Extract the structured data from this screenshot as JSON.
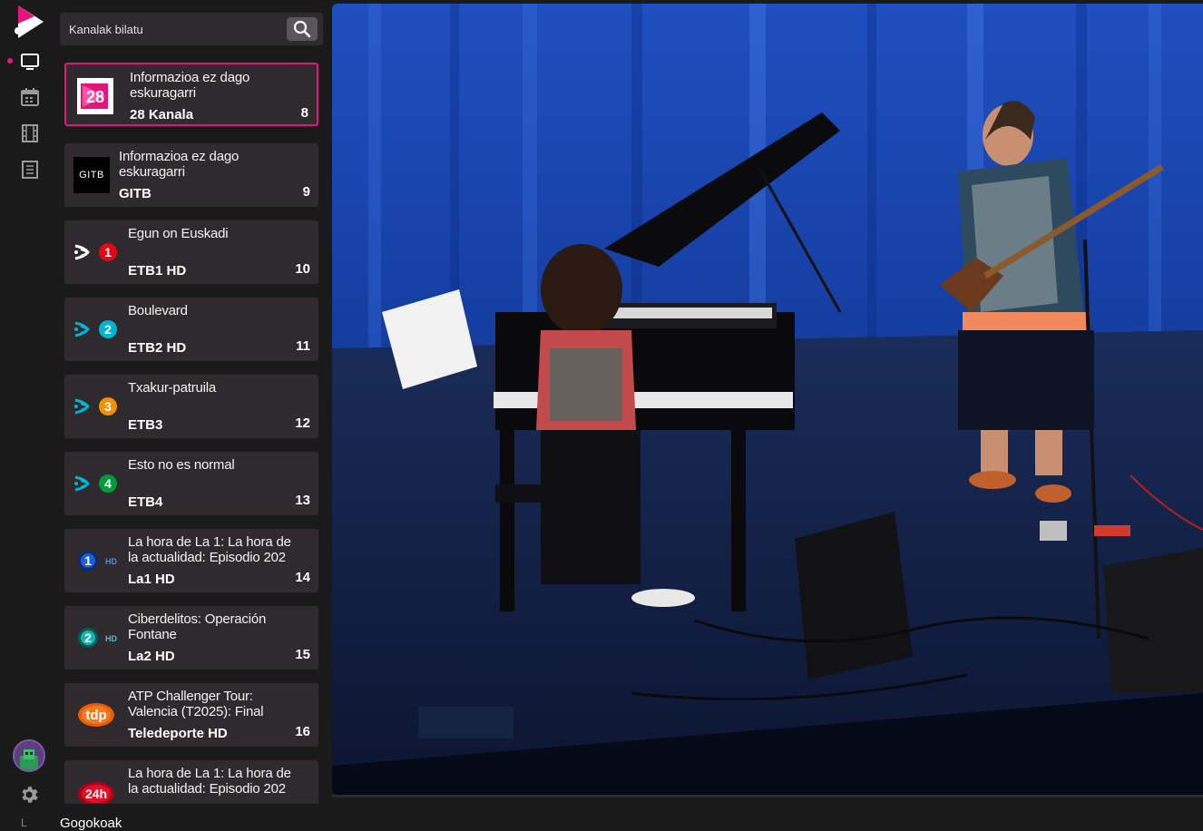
{
  "search": {
    "placeholder": "Kanalak bilatu"
  },
  "rail": {
    "items": [
      {
        "name": "tv",
        "icon": "tv-icon",
        "active": true
      },
      {
        "name": "calendar",
        "icon": "calendar-icon",
        "active": false
      },
      {
        "name": "film",
        "icon": "film-icon",
        "active": false
      },
      {
        "name": "document",
        "icon": "document-icon",
        "active": false
      }
    ],
    "bottom_char": "L",
    "accent": "#e3157b"
  },
  "channels": [
    {
      "program": "Informazioa ez dago eskuragarri",
      "name": "28 Kanala",
      "number": "8",
      "logo": "28-kanala-logo",
      "active": true
    },
    {
      "program": "Informazioa ez dago eskuragarri",
      "name": "GITB",
      "number": "9",
      "logo": "gitb-logo",
      "logo_text": "GITB"
    },
    {
      "program": "Egun on Euskadi",
      "name": "ETB1 HD",
      "number": "10",
      "logo": "etb1-logo",
      "logo_digit": "1"
    },
    {
      "program": "Boulevard",
      "name": "ETB2 HD",
      "number": "11",
      "logo": "etb2-logo",
      "logo_digit": "2"
    },
    {
      "program": "Txakur-patruila",
      "name": "ETB3",
      "number": "12",
      "logo": "etb3-logo",
      "logo_digit": "3"
    },
    {
      "program": "Esto no es normal",
      "name": "ETB4",
      "number": "13",
      "logo": "etb4-logo",
      "logo_digit": "4"
    },
    {
      "program": "La hora de La 1: La hora de la actualidad: Episodio 202",
      "name": "La1 HD",
      "number": "14",
      "logo": "la1-logo",
      "logo_digit": "1",
      "logo_suffix": "HD"
    },
    {
      "program": "Ciberdelitos: Operación Fontane",
      "name": "La2 HD",
      "number": "15",
      "logo": "la2-logo",
      "logo_digit": "2",
      "logo_suffix": "HD"
    },
    {
      "program": "ATP Challenger Tour: Valencia (T2025): Final",
      "name": "Teledeporte HD",
      "number": "16",
      "logo": "tdp-logo",
      "logo_text": "tdp"
    },
    {
      "program": "La hora de La 1: La hora de la actualidad: Episodio 202",
      "name": "",
      "number": "",
      "logo": "24h-logo",
      "logo_text": "24h"
    }
  ],
  "favorites_label": "Gogokoak",
  "colors": {
    "card_bg": "#2f2a2e",
    "active_border": "#e3157b",
    "etb1": "#e30613",
    "etb2": "#00b5d1",
    "etb3": "#f39200",
    "etb4": "#009a3d"
  }
}
